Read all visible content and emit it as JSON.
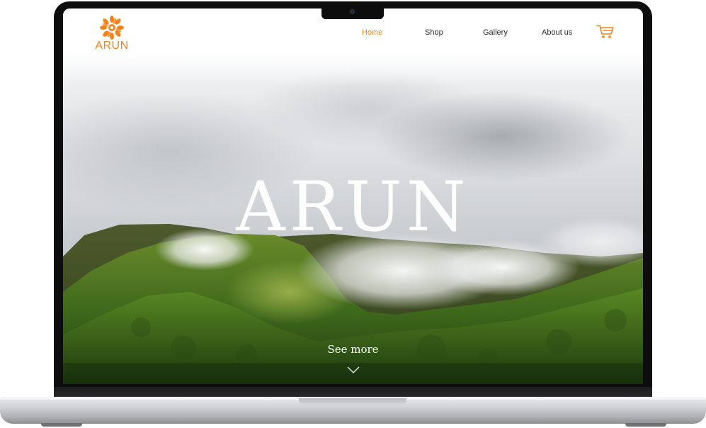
{
  "brand": {
    "name": "ARUN",
    "accent_color": "#f2841e",
    "logo_icon": "sun-mandala-icon"
  },
  "nav": {
    "items": [
      {
        "label": "Home",
        "active": true
      },
      {
        "label": "Shop",
        "active": false
      },
      {
        "label": "Gallery",
        "active": false
      },
      {
        "label": "About us",
        "active": false
      }
    ],
    "cart_icon": "shopping-cart-icon"
  },
  "hero": {
    "title": "ARUN",
    "cta_label": "See more",
    "cta_icon": "chevron-down-icon"
  },
  "device": {
    "frame": "laptop"
  }
}
